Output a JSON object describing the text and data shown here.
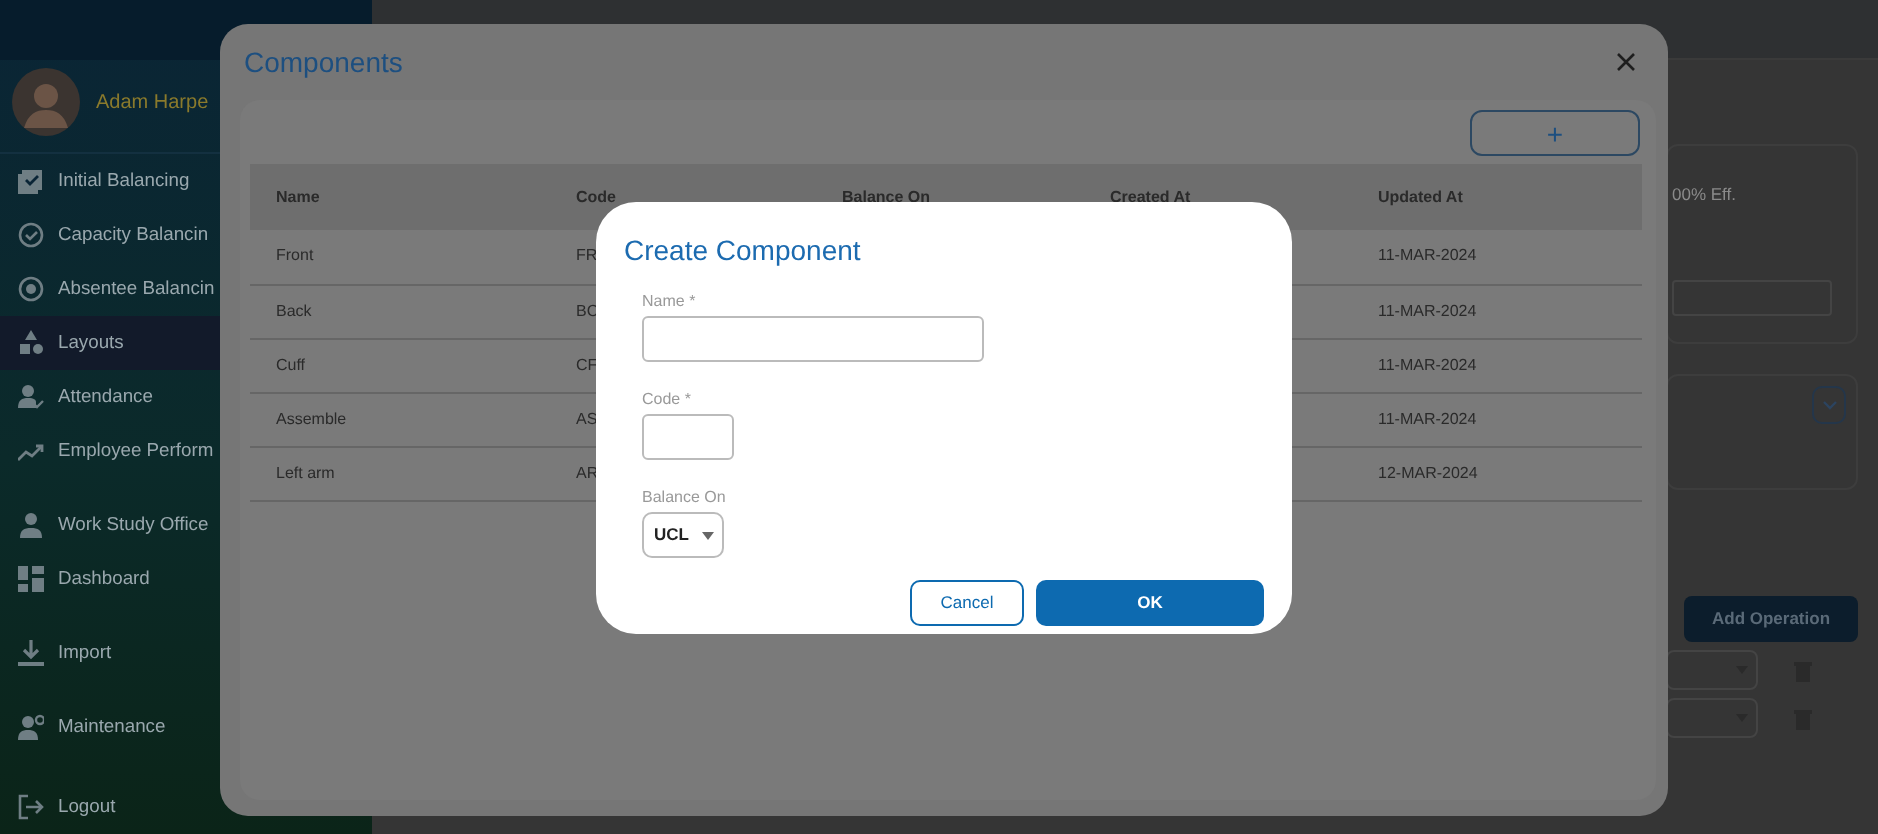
{
  "sidebar": {
    "user_name": "Adam  Harpe",
    "item_groups": [
      [
        {
          "label": "Initial Balancing",
          "selected": false
        },
        {
          "label": "Capacity Balancin",
          "selected": false
        },
        {
          "label": "Absentee Balancin",
          "selected": false
        },
        {
          "label": "Layouts",
          "selected": true
        },
        {
          "label": "Attendance",
          "selected": false
        },
        {
          "label": "Employee Perform",
          "selected": false
        }
      ],
      [
        {
          "label": "Work Study Office",
          "selected": false
        },
        {
          "label": "Dashboard",
          "selected": false
        }
      ],
      [
        {
          "label": "Import",
          "selected": false
        }
      ],
      [
        {
          "label": "Maintenance",
          "selected": false
        }
      ],
      [
        {
          "label": "Logout",
          "selected": false
        }
      ]
    ]
  },
  "main": {
    "efficiency_text": "00% Eff.",
    "add_operation_button": "Add Operation"
  },
  "components_dialog": {
    "title": "Components",
    "add_button": "+",
    "columns": [
      "Name",
      "Code",
      "Balance On",
      "Created At",
      "Updated At"
    ],
    "rows": [
      {
        "name": "Front",
        "code": "FR",
        "updated_at": "11-MAR-2024"
      },
      {
        "name": "Back",
        "code": "BC",
        "updated_at": "11-MAR-2024"
      },
      {
        "name": "Cuff",
        "code": "CF",
        "updated_at": "11-MAR-2024"
      },
      {
        "name": "Assemble",
        "code": "AS",
        "updated_at": "11-MAR-2024"
      },
      {
        "name": "Left arm",
        "code": "AR",
        "updated_at": "12-MAR-2024"
      }
    ]
  },
  "create_dialog": {
    "title": "Create Component",
    "fields": [
      {
        "label": "Name *",
        "kind": "text"
      },
      {
        "label": "Code *",
        "kind": "short-text"
      },
      {
        "label": "Balance On",
        "kind": "select",
        "value": "UCL"
      }
    ],
    "buttons": [
      {
        "label": "Cancel",
        "kind": "secondary"
      },
      {
        "label": "OK",
        "kind": "primary"
      }
    ]
  }
}
